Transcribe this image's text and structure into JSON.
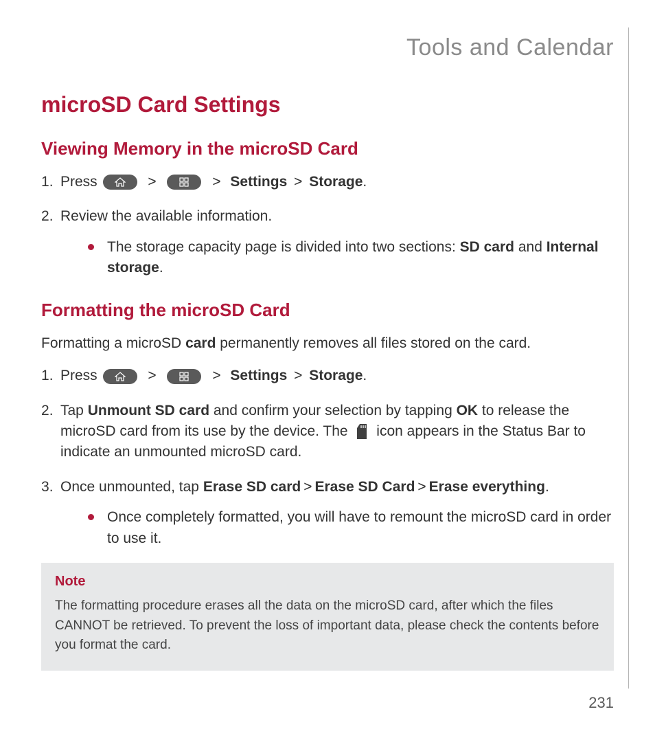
{
  "chapter": "Tools and Calendar",
  "title": "microSD Card Settings",
  "section1": {
    "heading": "Viewing Memory in the microSD Card",
    "step1_a": "Press ",
    "step1_b": "Settings",
    "step1_c": "Storage",
    "step2": "Review the available information.",
    "bullet_a": "The storage capacity page is divided into two sections: ",
    "bullet_sd": "SD card",
    "bullet_and": " and ",
    "bullet_int": "Internal storage",
    "bullet_dot": "."
  },
  "section2": {
    "heading": "Formatting the microSD Card",
    "intro_a": "Formatting a microSD ",
    "intro_b": "card",
    "intro_c": " permanently removes all files stored on the card.",
    "step1_a": "Press ",
    "step1_b": "Settings",
    "step1_c": "Storage",
    "step2_a": "Tap ",
    "step2_unmount": "Unmount SD card",
    "step2_b": " and confirm your selection by tapping ",
    "step2_ok": "OK",
    "step2_c": " to release the microSD card from its use by the device. The ",
    "step2_d": " icon appears in the Status Bar to indicate an unmounted microSD card.",
    "step3_a": "Once unmounted, tap ",
    "step3_e1": "Erase SD card",
    "step3_e2": "Erase SD Card",
    "step3_e3": "Erase everything",
    "step3_dot": ".",
    "bullet": "Once completely formatted, you will have to remount the microSD card in order to use it."
  },
  "note": {
    "title": "Note",
    "text": "The formatting procedure erases all the data on the microSD card, after which the files CANNOT be retrieved. To prevent the loss of important data, please check the contents before you format the card."
  },
  "sep": ">",
  "page": "231"
}
